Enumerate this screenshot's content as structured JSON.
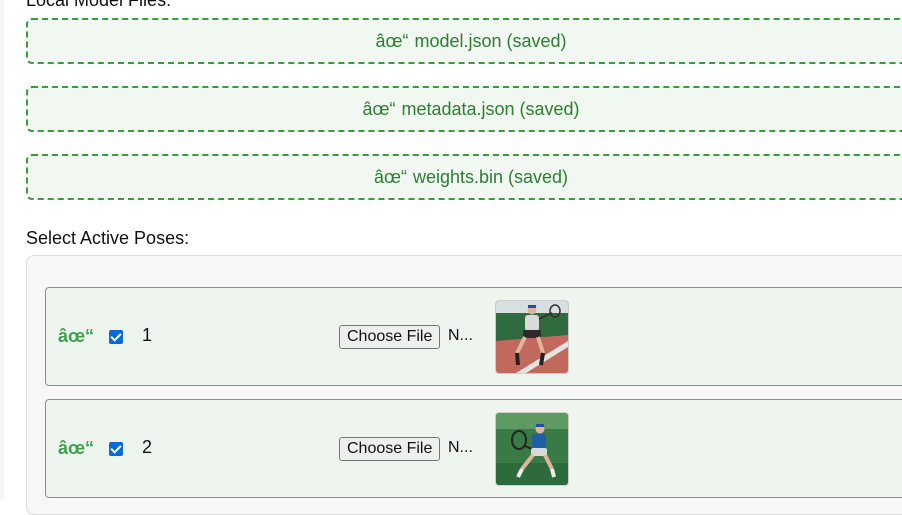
{
  "local_model_files": {
    "label": "Local Model Files:",
    "files": [
      {
        "check": "âœ“",
        "name": "model.json (saved)"
      },
      {
        "check": "âœ“",
        "name": "metadata.json (saved)"
      },
      {
        "check": "âœ“",
        "name": "weights.bin (saved)"
      }
    ]
  },
  "poses": {
    "label": "Select Active Poses:",
    "items": [
      {
        "status": "âœ“",
        "checked": true,
        "number": "1",
        "file_button": "Choose File",
        "file_status": "N..."
      },
      {
        "status": "âœ“",
        "checked": true,
        "number": "2",
        "file_button": "Choose File",
        "file_status": "N..."
      }
    ]
  },
  "colors": {
    "accent_green": "#3c9a3c",
    "checkbox_blue": "#0b6bd6"
  }
}
